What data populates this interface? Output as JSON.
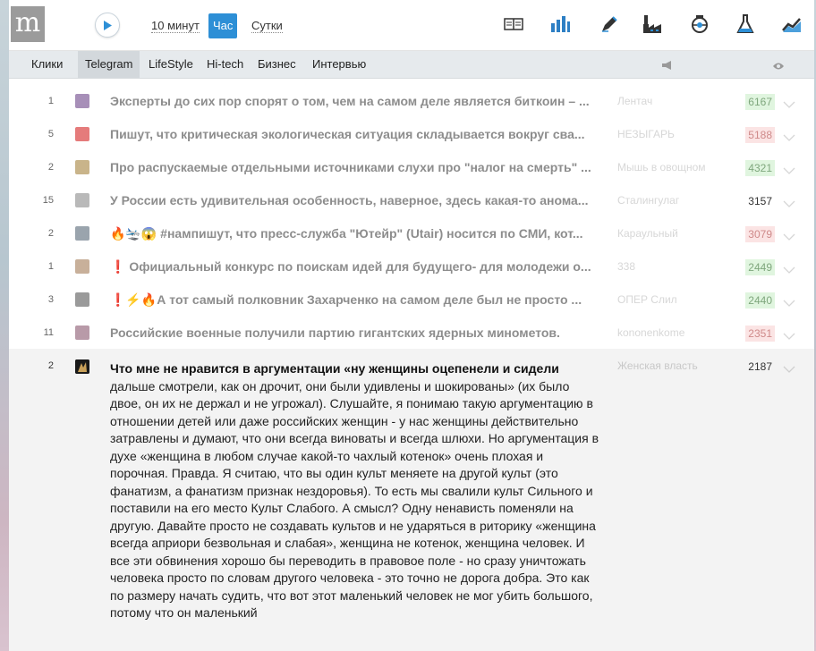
{
  "header": {
    "logo": "m",
    "periods": [
      {
        "label": "10 минут"
      },
      {
        "label": "Час"
      },
      {
        "label": "Сутки"
      }
    ],
    "icons": [
      "columns-icon",
      "bar-chart-icon",
      "pen-icon",
      "factory-icon",
      "sport-icon",
      "flask-icon",
      "trend-icon"
    ]
  },
  "tabs": [
    {
      "label": "Клики"
    },
    {
      "label": "Telegram"
    },
    {
      "label": "LifeStyle"
    },
    {
      "label": "Hi-tech"
    },
    {
      "label": "Бизнес"
    },
    {
      "label": "Интервью"
    }
  ],
  "rows": [
    {
      "rank": "1",
      "title": "Эксперты до сих пор спорят о том, чем на самом деле является биткоин – ...",
      "source": "Лентач",
      "views": "6167",
      "views_state": "green",
      "thumb_color": "#a78fb8"
    },
    {
      "rank": "5",
      "title": "Пишут, что критическая экологическая ситуация складывается вокруг сва...",
      "source": "НЕЗЫГАРЬ",
      "views": "5188",
      "views_state": "red",
      "thumb_color": "#e57b7b"
    },
    {
      "rank": "2",
      "title": "Про распускаемые отдельными источниками слухи про \"налог на смерть\" ...",
      "source": "Мышь в овощном",
      "views": "4321",
      "views_state": "green",
      "thumb_color": "#c9b48a"
    },
    {
      "rank": "15",
      "title": "У России есть удивительная особенность, наверное, здесь какая-то анома...",
      "source": "Сталингулаг",
      "views": "3157",
      "views_state": "plain",
      "thumb_color": "#b9b9b9"
    },
    {
      "rank": "2",
      "title": "🔥🛬😱 #нампишут, что пресс-служба \"Ютейр\" (Utair) носится по СМИ, кот...",
      "source": "Караульный",
      "views": "3079",
      "views_state": "red",
      "thumb_color": "#9aa4ad"
    },
    {
      "rank": "1",
      "title": "❗ Официальный конкурс по поискам идей для будущего- для молодежи о...",
      "source": "338",
      "views": "2449",
      "views_state": "green",
      "thumb_color": "#c8b09a"
    },
    {
      "rank": "3",
      "title": "❗⚡🔥А тот самый полковник Захарченко на самом деле был не просто ...",
      "source": "ОПЕР Слил",
      "views": "2440",
      "views_state": "green",
      "thumb_color": "#9a9a9a"
    },
    {
      "rank": "11",
      "title": "Российские военные получили партию гигантских ядерных минометов.",
      "source": "kononenkome",
      "views": "2351",
      "views_state": "red",
      "thumb_color": "#b89aa8"
    }
  ],
  "expanded": {
    "rank": "2",
    "title_bold": "Что мне не нравится в аргументации «ну женщины оцепенели и сидели",
    "body": " дальше смотрели, как он дрочит, они были удивлены и шокированы» (их было двое, он их не держал и не угрожал). Слушайте, я понимаю такую аргументацию в отношении детей или даже российских женщин - у нас женщины действительно затравлены и думают, что они всегда виноваты и всегда шлюхи. Но аргументация в духе «женщина в любом случае какой-то чахлый котенок» очень плохая и порочная. Правда. Я считаю, что вы один культ меняете на другой культ (это фанатизм, а фанатизм признак нездоровья). То есть мы свалили культ Сильного и поставили на его место Культ Слабого. А смысл? Одну ненависть поменяли на другую. Давайте просто не создавать культов и не ударяться в риторику «женщина всегда априори безвольная и слабая», женщина не котенок, женщина человек. И все эти обвинения хорошо бы переводить в правовое поле - но сразу уничтожать человека просто по словам другого человека - это точно не дорога добра. Это как по размеру начать судить, что вот этот маленький человек не мог убить большого, потому что он маленький",
    "source": "Женская власть",
    "views": "2187"
  },
  "colors": {
    "accent": "#2d8fd6",
    "views_green_bg": "#e0f5df",
    "views_red_bg": "#fbe4e4"
  }
}
